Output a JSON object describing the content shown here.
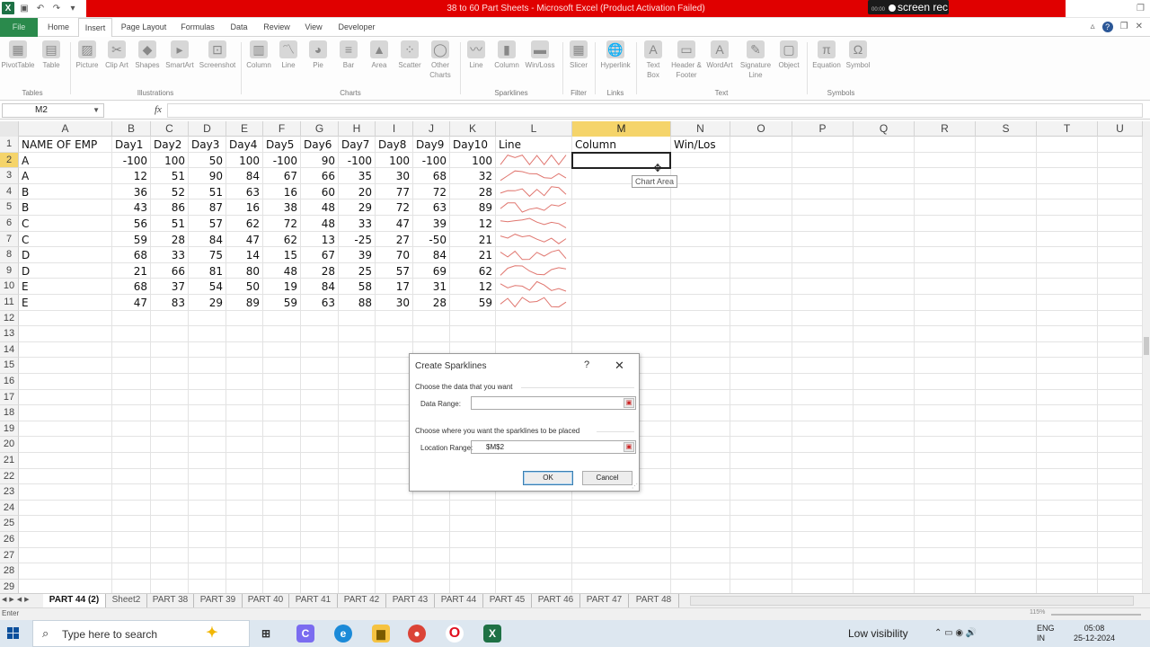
{
  "window": {
    "title": "38 to 60 Part Sheets - Microsoft Excel (Product Activation Failed)",
    "recorder": "screen rec",
    "recorder_time": "00:00"
  },
  "ribbon_tabs": [
    "File",
    "Home",
    "Insert",
    "Page Layout",
    "Formulas",
    "Data",
    "Review",
    "View",
    "Developer"
  ],
  "active_tab": "Insert",
  "ribbon": {
    "buttons": {
      "pivottable": "PivotTable",
      "table": "Table",
      "picture": "Picture",
      "clipart": "Clip Art",
      "shapes": "Shapes",
      "smartart": "SmartArt",
      "screenshot": "Screenshot",
      "column": "Column",
      "line": "Line",
      "pie": "Pie",
      "bar": "Bar",
      "area": "Area",
      "scatter": "Scatter",
      "other": "Other Charts",
      "sp_line": "Line",
      "sp_column": "Column",
      "sp_winloss": "Win/Loss",
      "slicer": "Slicer",
      "hyperlink": "Hyperlink",
      "textbox": "Text Box",
      "header": "Header & Footer",
      "wordart": "WordArt",
      "sigline": "Signature Line",
      "object": "Object",
      "equation": "Equation",
      "symbol": "Symbol"
    },
    "groups": {
      "tables": "Tables",
      "illustrations": "Illustrations",
      "charts": "Charts",
      "sparklines": "Sparklines",
      "filter": "Filter",
      "links": "Links",
      "text": "Text",
      "symbols": "Symbols"
    }
  },
  "formula_bar": {
    "name_box": "M2",
    "fx": "fx",
    "value": ""
  },
  "sheet": {
    "columns": [
      "A",
      "B",
      "C",
      "D",
      "E",
      "F",
      "G",
      "H",
      "I",
      "J",
      "K",
      "L",
      "M",
      "N",
      "O",
      "P",
      "Q",
      "R",
      "S",
      "T",
      "U"
    ],
    "selected_column": "M",
    "row_numbers": [
      "1",
      "2",
      "3",
      "4",
      "5",
      "6",
      "7",
      "8",
      "9",
      "10",
      "11",
      "12",
      "13",
      "14",
      "15",
      "16",
      "17",
      "18",
      "19",
      "20",
      "21",
      "22",
      "23",
      "24",
      "25",
      "26",
      "27",
      "28",
      "29"
    ],
    "selected_row": "2",
    "header_row": [
      "NAME OF EMP",
      "Day1",
      "Day2",
      "Day3",
      "Day4",
      "Day5",
      "Day6",
      "Day7",
      "Day8",
      "Day9",
      "Day10",
      "Line",
      "Column",
      "Win/Los"
    ],
    "data_rows": [
      [
        "A",
        "-100",
        "100",
        "50",
        "100",
        "-100",
        "90",
        "-100",
        "100",
        "-100",
        "100"
      ],
      [
        "A",
        "12",
        "51",
        "90",
        "84",
        "67",
        "66",
        "35",
        "30",
        "68",
        "32"
      ],
      [
        "B",
        "36",
        "52",
        "51",
        "63",
        "16",
        "60",
        "20",
        "77",
        "72",
        "28"
      ],
      [
        "B",
        "43",
        "86",
        "87",
        "16",
        "38",
        "48",
        "29",
        "72",
        "63",
        "89"
      ],
      [
        "C",
        "56",
        "51",
        "57",
        "62",
        "72",
        "48",
        "33",
        "47",
        "39",
        "12"
      ],
      [
        "C",
        "59",
        "28",
        "84",
        "47",
        "62",
        "13",
        "-25",
        "27",
        "-50",
        "21"
      ],
      [
        "D",
        "68",
        "33",
        "75",
        "14",
        "15",
        "67",
        "39",
        "70",
        "84",
        "21"
      ],
      [
        "D",
        "21",
        "66",
        "81",
        "80",
        "48",
        "28",
        "25",
        "57",
        "69",
        "62"
      ],
      [
        "E",
        "68",
        "37",
        "54",
        "50",
        "19",
        "84",
        "58",
        "17",
        "31",
        "12"
      ],
      [
        "E",
        "47",
        "83",
        "29",
        "89",
        "59",
        "63",
        "88",
        "30",
        "28",
        "59"
      ]
    ],
    "sparkline_color": "#e0766f",
    "tooltip": "Chart Area"
  },
  "dialog": {
    "title": "Create Sparklines",
    "help": "?",
    "close": "✕",
    "section1": "Choose the data that you want",
    "data_range_label": "Data Range:",
    "data_range_value": "",
    "section2": "Choose where you want the sparklines to be placed",
    "location_range_label": "Location Range:",
    "location_range_value": "$M$2",
    "ok": "OK",
    "cancel": "Cancel"
  },
  "sheet_tabs": [
    "PART 44 (2)",
    "Sheet2",
    "PART 38",
    "PART 39",
    "PART 40",
    "PART 41",
    "PART 42",
    "PART 43",
    "PART 44",
    "PART 45",
    "PART 46",
    "PART 47",
    "PART 48"
  ],
  "active_sheet": "PART 44 (2)",
  "status": {
    "mode": "Enter",
    "zoom": "115%"
  },
  "taskbar": {
    "search_placeholder": "Type here to search",
    "weather": "Low visibility",
    "lang1": "ENG",
    "lang2": "IN",
    "time": "05:08",
    "date": "25-12-2024"
  }
}
